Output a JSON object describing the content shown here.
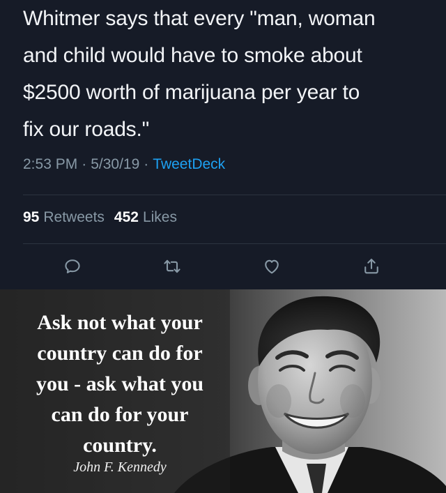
{
  "tweet": {
    "text_lines": [
      "Whitmer says that every \"man, woman",
      "and child would have to smoke about",
      "$2500 worth of marijuana per year to",
      "fix our roads.\""
    ],
    "time": "2:53 PM",
    "date": "5/30/19",
    "source": "TweetDeck",
    "retweets_count": "95",
    "retweets_label": "Retweets",
    "likes_count": "452",
    "likes_label": "Likes",
    "actions": [
      {
        "name": "reply",
        "icon": "speech-bubble-icon"
      },
      {
        "name": "retweet",
        "icon": "retweet-arrows-icon"
      },
      {
        "name": "like",
        "icon": "heart-icon"
      },
      {
        "name": "share",
        "icon": "share-upload-icon"
      }
    ],
    "colors": {
      "background": "#161b27",
      "text": "#f2f4f7",
      "muted": "#8899a6",
      "link": "#1da1f2"
    }
  },
  "meme": {
    "quote_lines": [
      "Ask not what your",
      "country can do for",
      "you - ask what you",
      "can do for your",
      "country."
    ],
    "author": "John F. Kennedy"
  }
}
